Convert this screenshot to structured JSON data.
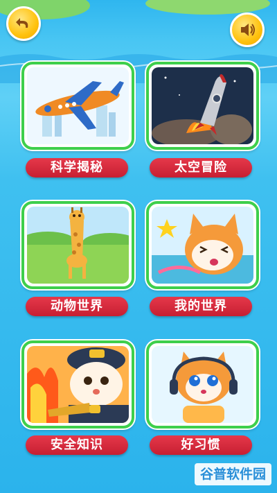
{
  "header": {
    "back_icon": "back-arrow-icon",
    "sound_icon": "speaker-icon"
  },
  "categories": [
    {
      "label": "科学揭秘",
      "image": "airplane-illustration"
    },
    {
      "label": "太空冒险",
      "image": "rocket-launch-illustration"
    },
    {
      "label": "动物世界",
      "image": "giraffe-illustration"
    },
    {
      "label": "我的世界",
      "image": "cat-with-star-illustration"
    },
    {
      "label": "安全知识",
      "image": "firefighter-cat-illustration"
    },
    {
      "label": "好习惯",
      "image": "cat-with-headphones-illustration"
    }
  ],
  "watermark": "谷普软件园",
  "colors": {
    "label_red": "#d42a3c",
    "card_border": "#3ecf4c",
    "button_yellow": "#ffc20e"
  }
}
